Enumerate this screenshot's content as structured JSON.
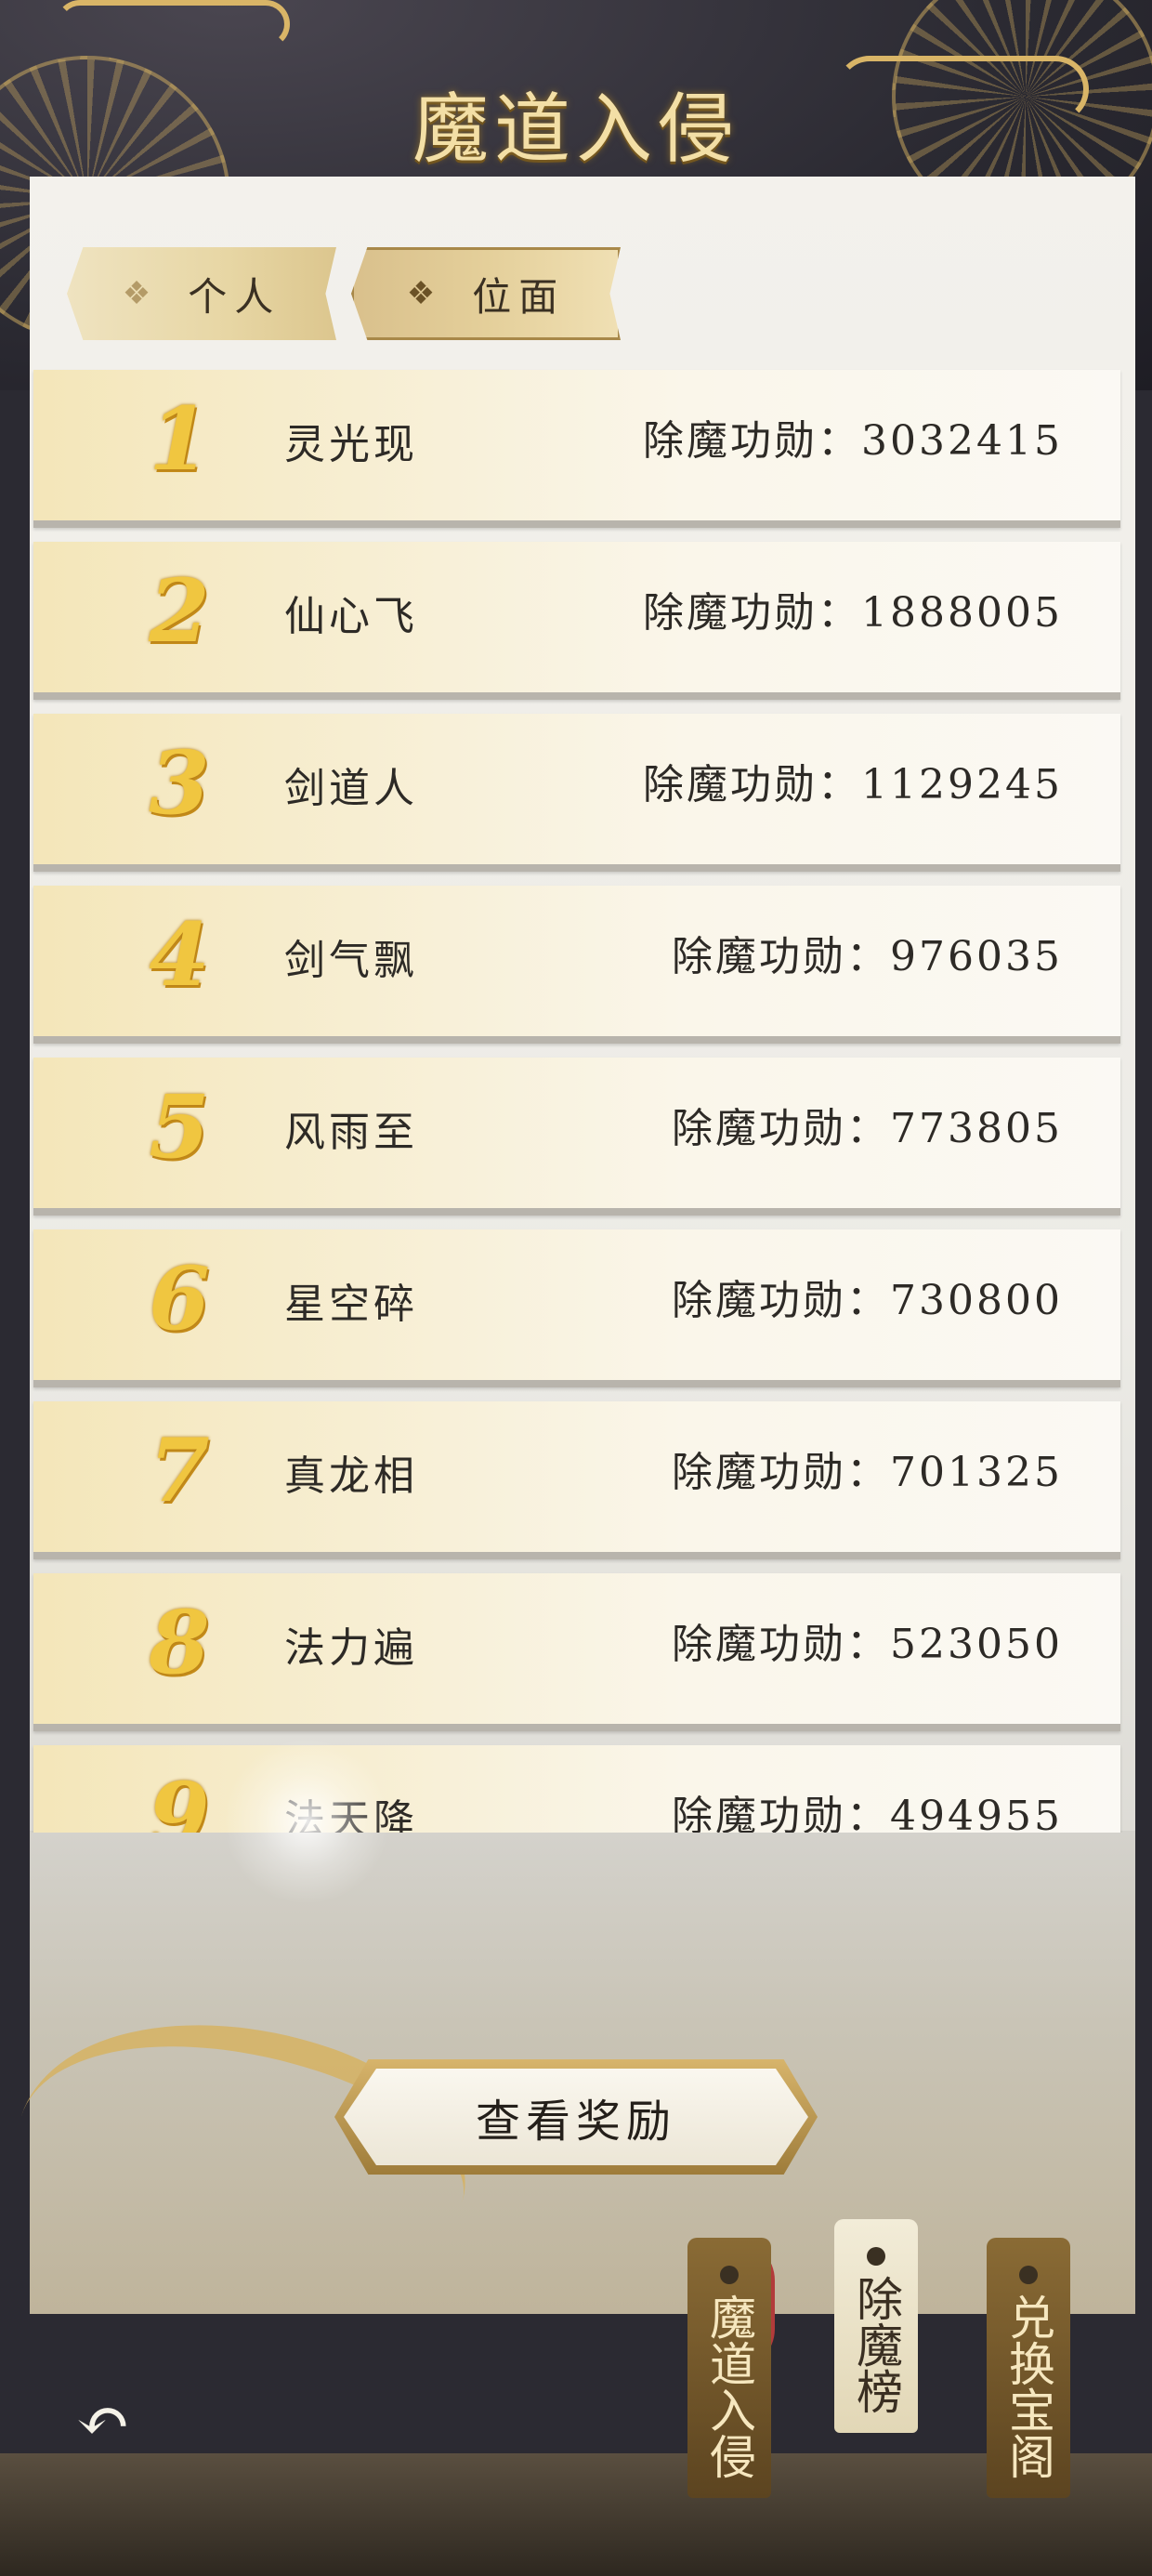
{
  "header": {
    "title": "魔道入侵"
  },
  "tabs": [
    {
      "label": "个人",
      "active": false
    },
    {
      "label": "位面",
      "active": true
    }
  ],
  "leaderboard": {
    "merit_prefix": "除魔功勋：",
    "rows": [
      {
        "rank": "1",
        "name": "灵光现",
        "merit": "3032415"
      },
      {
        "rank": "2",
        "name": "仙心飞",
        "merit": "1888005"
      },
      {
        "rank": "3",
        "name": "剑道人",
        "merit": "1129245"
      },
      {
        "rank": "4",
        "name": "剑气飘",
        "merit": "976035"
      },
      {
        "rank": "5",
        "name": "风雨至",
        "merit": "773805"
      },
      {
        "rank": "6",
        "name": "星空碎",
        "merit": "730800"
      },
      {
        "rank": "7",
        "name": "真龙相",
        "merit": "701325"
      },
      {
        "rank": "8",
        "name": "法力遍",
        "merit": "523050"
      },
      {
        "rank": "9",
        "name": "法天降",
        "merit": "494955"
      }
    ]
  },
  "reward_button": {
    "label": "查看奖励"
  },
  "back_button": {
    "icon": "back-arrow-icon",
    "glyph": "↶"
  },
  "side_tags": [
    {
      "label": "魔道入侵",
      "style": "dark"
    },
    {
      "label": "除魔榜",
      "style": "light"
    },
    {
      "label": "兑换宝阁",
      "style": "dark"
    }
  ],
  "colors": {
    "rank_gold": "#f0c640",
    "title_gold": "#f3dfa6",
    "tag_dark": "#6e5228",
    "tag_light": "#ece4cb"
  }
}
